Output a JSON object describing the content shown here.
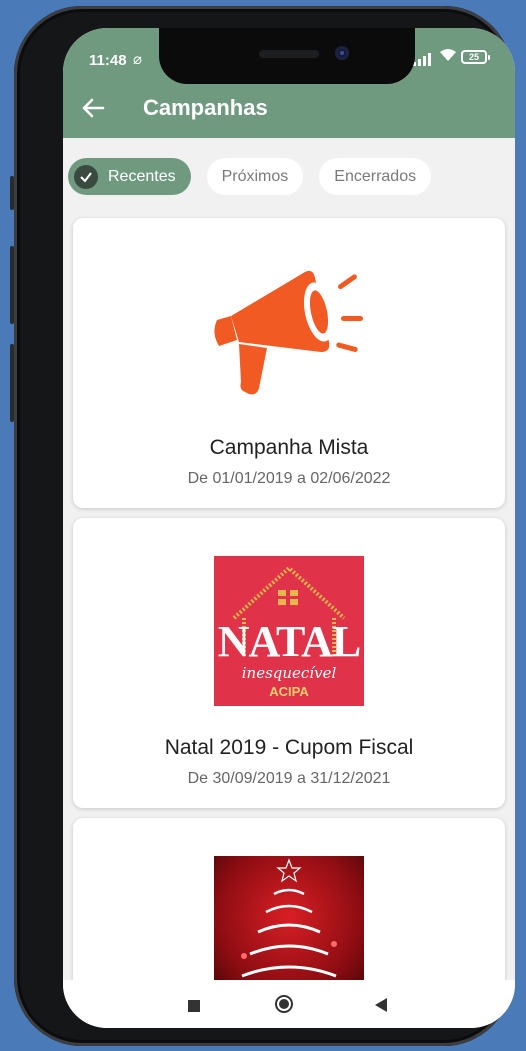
{
  "status_bar": {
    "time": "11:48",
    "battery": "25"
  },
  "app_bar": {
    "title": "Campanhas"
  },
  "filters": {
    "recent": "Recentes",
    "upcoming": "Próximos",
    "closed": "Encerrados",
    "selected": "Recentes"
  },
  "campaigns": [
    {
      "name": "Campanha Mista",
      "dates": "De 01/01/2019 a 02/06/2022",
      "image": "megaphone-icon"
    },
    {
      "name": "Natal 2019 - Cupom Fiscal",
      "dates": "De 30/09/2019 a 31/12/2021",
      "image": "natal-logo",
      "logo_text": {
        "main": "NATAL",
        "script": "inesquecível",
        "org": "ACIPA"
      }
    },
    {
      "name": "",
      "dates": "",
      "image": "christmas-tree-image"
    }
  ],
  "colors": {
    "primary": "#6f9a7f",
    "megaphone": "#f15a22",
    "natal_bg": "#e0334a",
    "background": "#f1f1f1"
  }
}
